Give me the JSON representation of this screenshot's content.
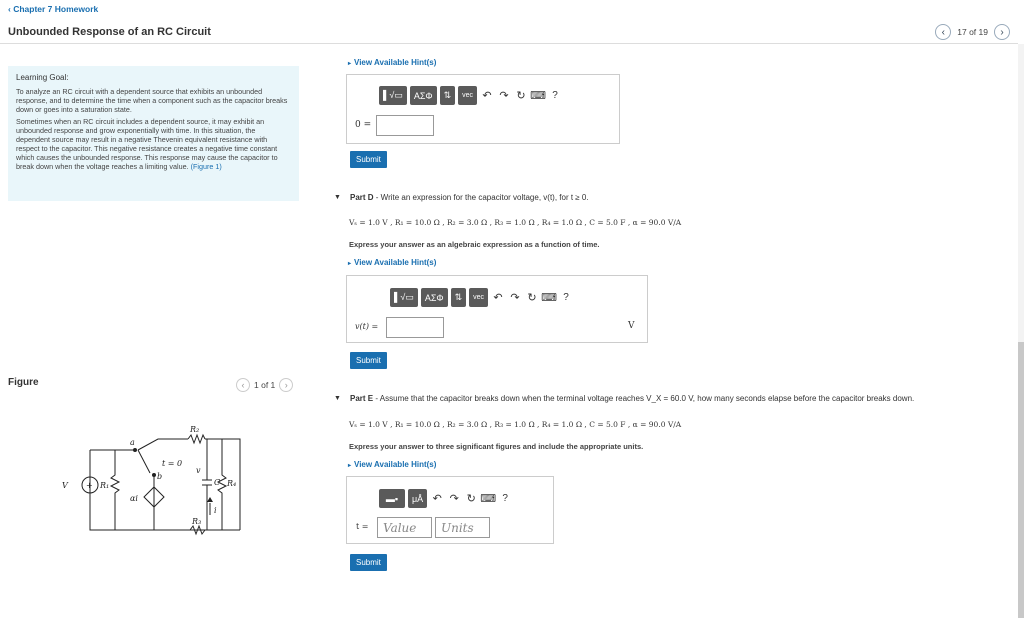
{
  "header": {
    "back_label": "Chapter 7 Homework",
    "title": "Unbounded Response of an RC Circuit",
    "pager_text": "17 of 19"
  },
  "goal": {
    "title": "Learning Goal:",
    "p1": "To analyze an RC circuit with a dependent source that exhibits an unbounded response, and to determine the time when a component such as the capacitor breaks down or goes into a saturation state.",
    "p2": "Sometimes when an RC circuit includes a dependent source, it may exhibit an unbounded response and grow exponentially with time. In this situation, the dependent source may result in a negative Thevenin equivalent resistance with respect to the capacitor. This negative resistance creates a negative time constant which causes the unbounded response. This response may cause the capacitor to break down when the voltage reaches a limiting value.",
    "fig_link": "(Figure 1)"
  },
  "figure": {
    "label": "Figure",
    "pager_text": "1 of 1"
  },
  "partC": {
    "hint": "View Available Hint(s)",
    "input_label": "0 =",
    "submit": "Submit"
  },
  "partD": {
    "head_bold": "Part D",
    "head_text": " - Write an expression for the capacitor voltage, v(t), for t ≥ 0.",
    "given": "Vₛ = 1.0 V , R₁ = 10.0 Ω , R₂ = 3.0 Ω , R₃ = 1.0 Ω , R₄ = 1.0 Ω , C = 5.0 F , α = 90.0 V/A",
    "instruction": "Express your answer as an algebraic expression as a function of time.",
    "hint": "View Available Hint(s)",
    "input_label": "v(t) =",
    "unit": "V",
    "submit": "Submit"
  },
  "partE": {
    "head_bold": "Part E",
    "head_text": " - Assume that the capacitor breaks down when the terminal voltage reaches V_X = 60.0 V, how many seconds elapse before the capacitor breaks down.",
    "given": "Vₛ = 1.0 V , R₁ = 10.0 Ω , R₂ = 3.0 Ω , R₃ = 1.0 Ω , R₄ = 1.0 Ω , C = 5.0 F , α = 90.0 V/A",
    "instruction": "Express your answer to three significant figures and include the appropriate units.",
    "hint": "View Available Hint(s)",
    "input_label": "t =",
    "value_placeholder": "Value",
    "units_placeholder": "Units",
    "submit": "Submit"
  },
  "toolbar": {
    "templates": "▌√▭",
    "greek": "ΑΣΦ",
    "arrows": "⇅",
    "vec": "vec",
    "units_btn": "μÅ",
    "help": "?"
  },
  "circuit": {
    "vs": "V",
    "r1": "R₁",
    "r2": "R₂",
    "r3": "R₃",
    "r4": "R₄",
    "cap": "C",
    "switch_label": "t = 0",
    "node_a": "a",
    "node_b": "b",
    "dep_src": "αi",
    "current": "i",
    "vplus": "+",
    "vminus": "−",
    "v_label": "v"
  }
}
